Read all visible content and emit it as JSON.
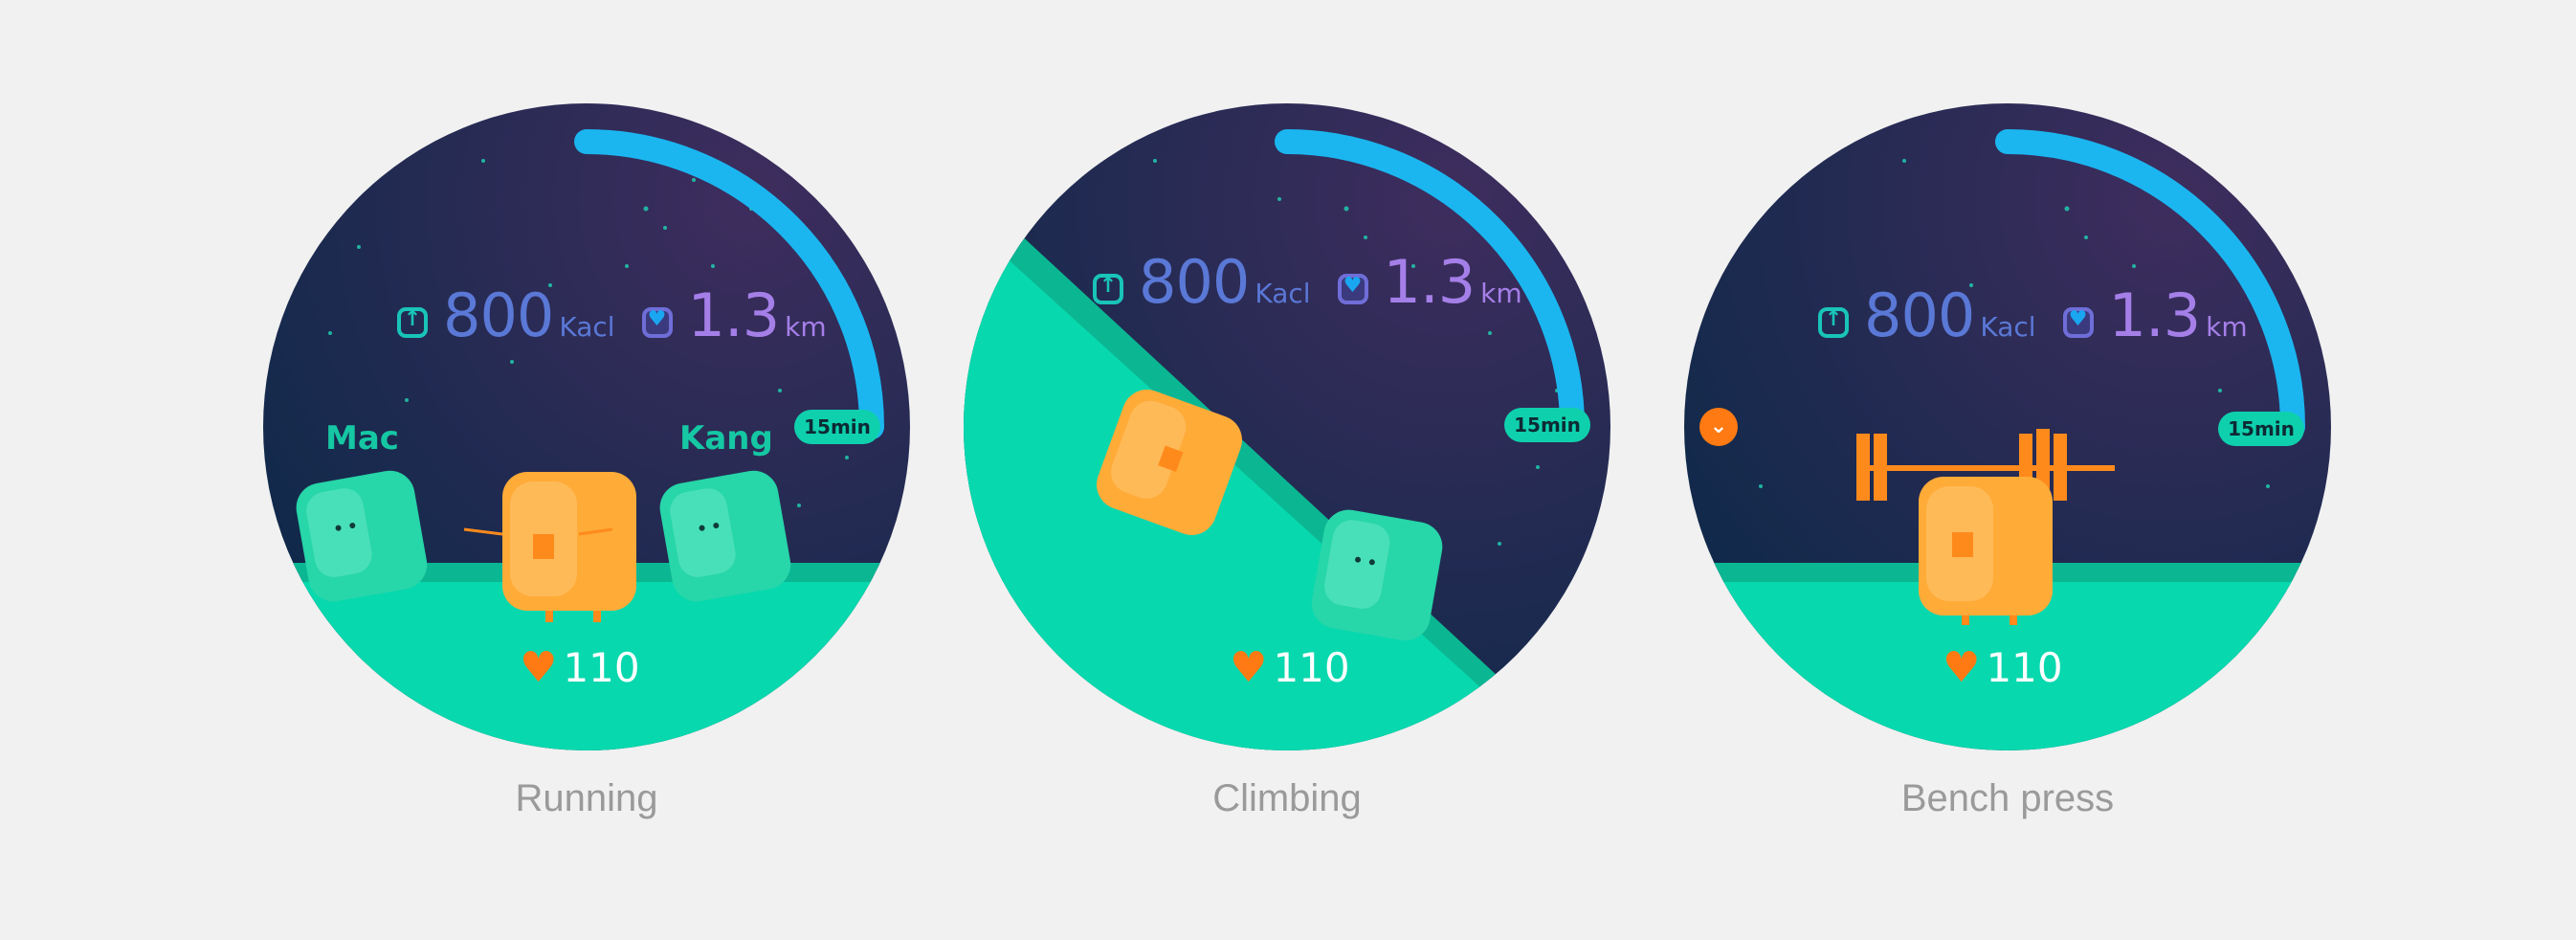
{
  "colors": {
    "background": "#f1f1f1",
    "sky_top": "#3a2c5c",
    "sky_bottom": "#12294a",
    "ground": "#08d8ae",
    "ground_dark": "#0bb793",
    "progress_arc": "#1bb6f0",
    "character_orange": "#ffab38",
    "character_teal": "#27d6a9",
    "heart": "#ff7a12",
    "calorie_text": "#5a78d6",
    "distance_text": "#a57fe8"
  },
  "screens": [
    {
      "caption": "Running",
      "calories": {
        "icon": "arrow-up-icon",
        "value": "800",
        "unit": "Kacl"
      },
      "distance": {
        "icon": "heart-icon",
        "value": "1.3",
        "unit": "km"
      },
      "duration": "15min",
      "heart_rate": "110",
      "progress": 0.3,
      "players": [
        "Mac",
        "Kang"
      ]
    },
    {
      "caption": "Climbing",
      "calories": {
        "icon": "arrow-up-icon",
        "value": "800",
        "unit": "Kacl"
      },
      "distance": {
        "icon": "heart-icon",
        "value": "1.3",
        "unit": "km"
      },
      "duration": "15min",
      "heart_rate": "110",
      "progress": 0.3
    },
    {
      "caption": "Bench press",
      "calories": {
        "icon": "arrow-up-icon",
        "value": "800",
        "unit": "Kacl"
      },
      "distance": {
        "icon": "heart-icon",
        "value": "1.3",
        "unit": "km"
      },
      "duration": "15min",
      "heart_rate": "110",
      "progress": 0.3,
      "side_button_icon": "chevron-down-icon"
    }
  ]
}
